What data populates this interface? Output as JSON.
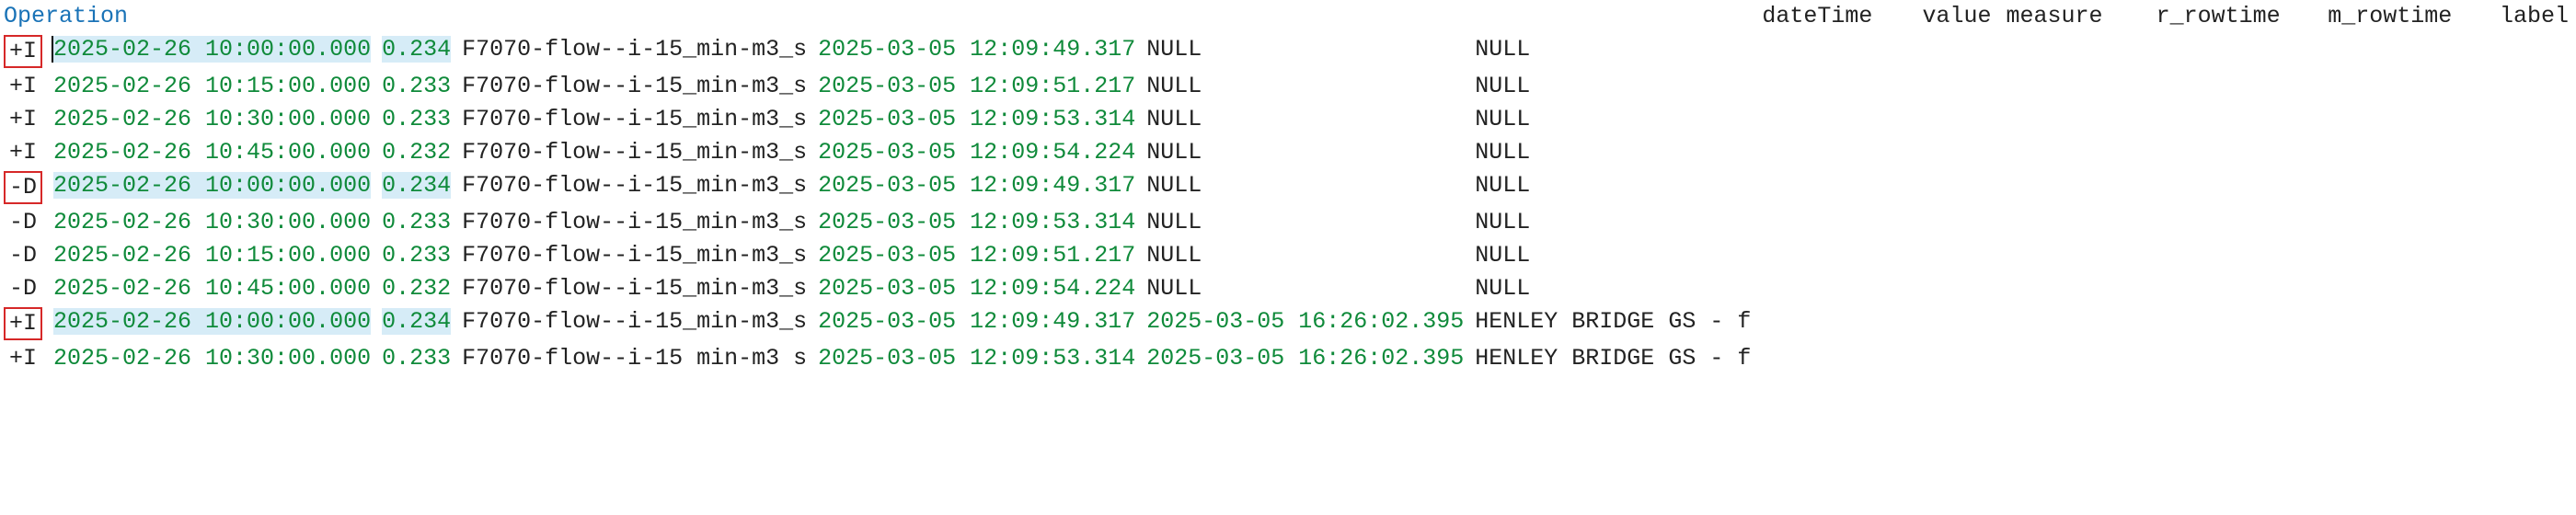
{
  "columns": {
    "op": "Operation",
    "dateTime": "dateTime",
    "value": "value",
    "measure": "measure",
    "r_rowtime": "r_rowtime",
    "m_rowtime": "m_rowtime",
    "label": "label"
  },
  "rows": [
    {
      "op": "+I",
      "op_boxed": true,
      "highlighted": true,
      "cursor": true,
      "dateTime": "2025-02-26 10:00:00.000",
      "value": "0.234",
      "measure": "F7070-flow--i-15_min-m3_s",
      "r_rowtime": "2025-03-05 12:09:49.317",
      "m_rowtime": null,
      "label": "NULL"
    },
    {
      "op": "+I",
      "op_boxed": false,
      "highlighted": false,
      "cursor": false,
      "dateTime": "2025-02-26 10:15:00.000",
      "value": "0.233",
      "measure": "F7070-flow--i-15_min-m3_s",
      "r_rowtime": "2025-03-05 12:09:51.217",
      "m_rowtime": null,
      "label": "NULL"
    },
    {
      "op": "+I",
      "op_boxed": false,
      "highlighted": false,
      "cursor": false,
      "dateTime": "2025-02-26 10:30:00.000",
      "value": "0.233",
      "measure": "F7070-flow--i-15_min-m3_s",
      "r_rowtime": "2025-03-05 12:09:53.314",
      "m_rowtime": null,
      "label": "NULL"
    },
    {
      "op": "+I",
      "op_boxed": false,
      "highlighted": false,
      "cursor": false,
      "dateTime": "2025-02-26 10:45:00.000",
      "value": "0.232",
      "measure": "F7070-flow--i-15_min-m3_s",
      "r_rowtime": "2025-03-05 12:09:54.224",
      "m_rowtime": null,
      "label": "NULL"
    },
    {
      "op": "-D",
      "op_boxed": true,
      "highlighted": true,
      "cursor": false,
      "dateTime": "2025-02-26 10:00:00.000",
      "value": "0.234",
      "measure": "F7070-flow--i-15_min-m3_s",
      "r_rowtime": "2025-03-05 12:09:49.317",
      "m_rowtime": null,
      "label": "NULL"
    },
    {
      "op": "-D",
      "op_boxed": false,
      "highlighted": false,
      "cursor": false,
      "dateTime": "2025-02-26 10:30:00.000",
      "value": "0.233",
      "measure": "F7070-flow--i-15_min-m3_s",
      "r_rowtime": "2025-03-05 12:09:53.314",
      "m_rowtime": null,
      "label": "NULL"
    },
    {
      "op": "-D",
      "op_boxed": false,
      "highlighted": false,
      "cursor": false,
      "dateTime": "2025-02-26 10:15:00.000",
      "value": "0.233",
      "measure": "F7070-flow--i-15_min-m3_s",
      "r_rowtime": "2025-03-05 12:09:51.217",
      "m_rowtime": null,
      "label": "NULL"
    },
    {
      "op": "-D",
      "op_boxed": false,
      "highlighted": false,
      "cursor": false,
      "dateTime": "2025-02-26 10:45:00.000",
      "value": "0.232",
      "measure": "F7070-flow--i-15_min-m3_s",
      "r_rowtime": "2025-03-05 12:09:54.224",
      "m_rowtime": null,
      "label": "NULL"
    },
    {
      "op": "+I",
      "op_boxed": true,
      "highlighted": true,
      "cursor": false,
      "dateTime": "2025-02-26 10:00:00.000",
      "value": "0.234",
      "measure": "F7070-flow--i-15_min-m3_s",
      "r_rowtime": "2025-03-05 12:09:49.317",
      "m_rowtime": "2025-03-05 16:26:02.395",
      "label": "HENLEY BRIDGE GS - f"
    },
    {
      "op": "+I",
      "op_boxed": false,
      "highlighted": false,
      "cursor": false,
      "dateTime": "2025-02-26 10:30:00.000",
      "value": "0.233",
      "measure": "F7070-flow--i-15 min-m3 s",
      "r_rowtime": "2025-03-05 12:09:53.314",
      "m_rowtime": "2025-03-05 16:26:02.395",
      "label": "HENLEY BRIDGE GS - f"
    }
  ],
  "null_text": "NULL"
}
